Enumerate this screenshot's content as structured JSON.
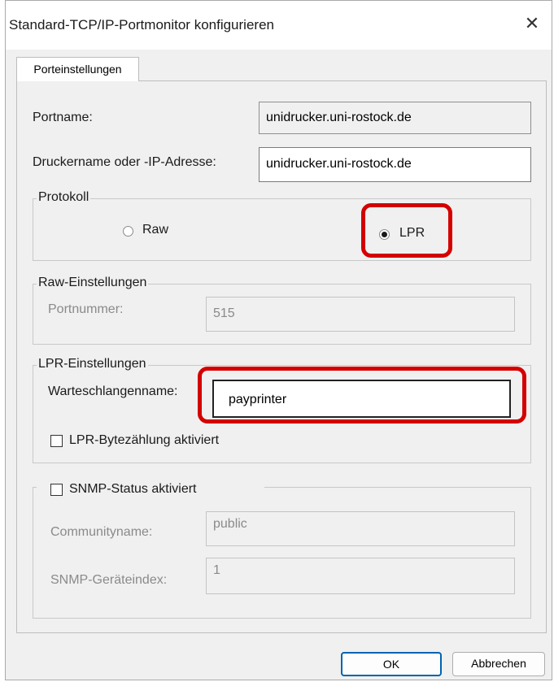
{
  "window": {
    "title": "Standard-TCP/IP-Portmonitor konfigurieren",
    "close_glyph": "✕"
  },
  "tab": {
    "label": "Porteinstellungen"
  },
  "port": {
    "name_label": "Portname:",
    "name_value": "unidrucker.uni-rostock.de",
    "host_label": "Druckername oder -IP-Adresse:",
    "host_value": "unidrucker.uni-rostock.de"
  },
  "protocol": {
    "title": "Protokoll",
    "raw_label": "Raw",
    "lpr_label": "LPR",
    "selected": "LPR"
  },
  "raw_settings": {
    "title": "Raw-Einstellungen",
    "port_label": "Portnummer:",
    "port_value": "515"
  },
  "lpr_settings": {
    "title": "LPR-Einstellungen",
    "queue_label": "Warteschlangenname:",
    "queue_value": "payprinter",
    "bytecount_label": "LPR-Bytezählung aktiviert",
    "bytecount_checked": false
  },
  "snmp": {
    "title": "SNMP-Status aktiviert",
    "enabled": false,
    "community_label": "Communityname:",
    "community_value": "public",
    "index_label": "SNMP-Geräteindex:",
    "index_value": "1"
  },
  "buttons": {
    "ok": "OK",
    "cancel": "Abbrechen"
  },
  "colors": {
    "highlight": "#d40000",
    "primary_border": "#0063b1",
    "dialog_bg": "#f0f0f0"
  }
}
